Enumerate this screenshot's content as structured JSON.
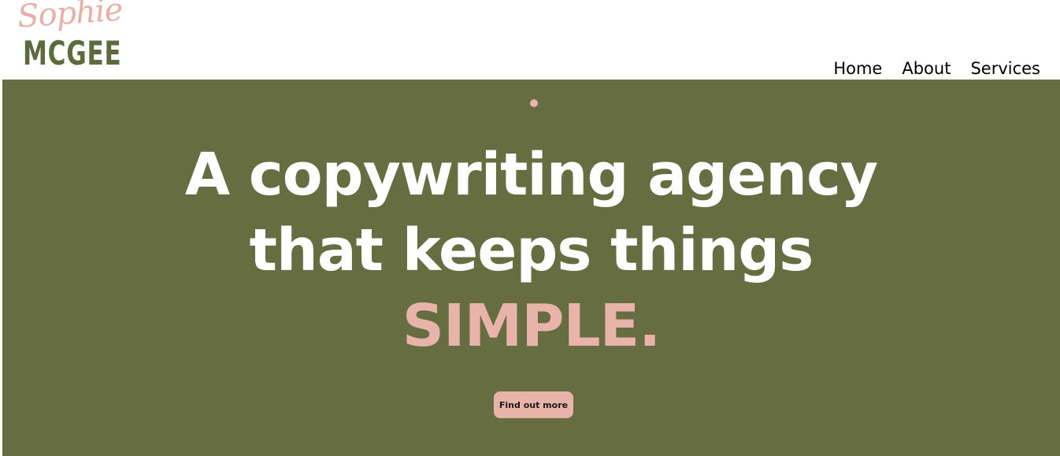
{
  "brand": {
    "script_name": "Sophie",
    "wordmark": "MCGEE",
    "colors": {
      "olive": "#666d41",
      "pink": "#e8b3a8",
      "logo_green": "#5d6a3e"
    }
  },
  "nav": {
    "items": [
      {
        "label": "Home",
        "active": true
      },
      {
        "label": "About",
        "active": false
      },
      {
        "label": "Services",
        "active": false
      }
    ]
  },
  "hero": {
    "headline_line1": "A copywriting agency",
    "headline_line2": "that keeps things",
    "headline_accent": "SIMPLE.",
    "cta_label": "Find out more"
  }
}
